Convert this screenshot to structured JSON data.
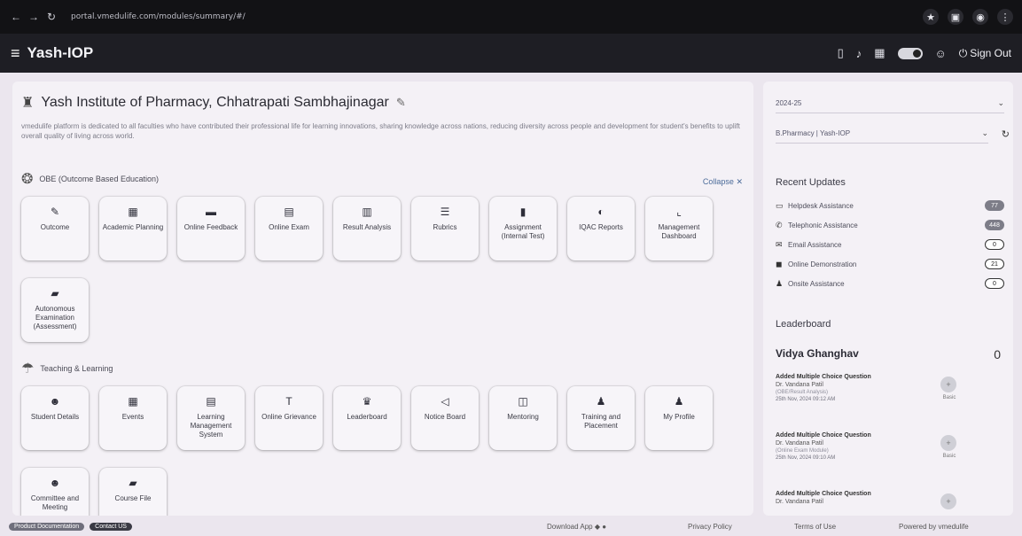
{
  "browser": {
    "url": "portal.vmedulife.com/modules/summary/#/"
  },
  "app": {
    "title": "Yash-IOP",
    "signout_label": "Sign Out"
  },
  "institute": {
    "title": "Yash Institute of Pharmacy, Chhatrapati Sambhajinagar",
    "description": "vmedulife platform is dedicated to all faculties who have contributed their professional life for learning innovations, sharing knowledge across nations, reducing diversity across people and development for student's benefits to uplift overall quality of living across world."
  },
  "obe": {
    "title": "OBE (Outcome Based Education)",
    "collapse_label": "Collapse",
    "tiles": [
      {
        "label": "Outcome",
        "icon": "✎"
      },
      {
        "label": "Academic Planning",
        "icon": "▦"
      },
      {
        "label": "Online Feedback",
        "icon": "▬"
      },
      {
        "label": "Online Exam",
        "icon": "▤"
      },
      {
        "label": "Result Analysis",
        "icon": "▥"
      },
      {
        "label": "Rubrics",
        "icon": "☰"
      },
      {
        "label": "Assignment (Internal Test)",
        "icon": "▮"
      },
      {
        "label": "IQAC Reports",
        "icon": "◐"
      },
      {
        "label": "Management Dashboard",
        "icon": "⌞"
      },
      {
        "label": "Autonomous Examination (Assessment)",
        "icon": "▰"
      }
    ]
  },
  "teaching": {
    "title": "Teaching & Learning",
    "tiles": [
      {
        "label": "Student Details",
        "icon": "☻"
      },
      {
        "label": "Events",
        "icon": "▦"
      },
      {
        "label": "Learning Management System",
        "icon": "▤"
      },
      {
        "label": "Online Grievance",
        "icon": "T"
      },
      {
        "label": "Leaderboard",
        "icon": "♛"
      },
      {
        "label": "Notice Board",
        "icon": "◁"
      },
      {
        "label": "Mentoring",
        "icon": "◫"
      },
      {
        "label": "Training and Placement",
        "icon": "♟"
      },
      {
        "label": "My Profile",
        "icon": "♟"
      },
      {
        "label": "Committee and Meeting",
        "icon": "☻"
      },
      {
        "label": "Course File",
        "icon": "▰"
      }
    ]
  },
  "right_panel": {
    "academic_year": "2024-25",
    "program": "B.Pharmacy | Yash-IOP",
    "recent_updates_title": "Recent Updates",
    "updates": [
      {
        "label": "Helpdesk Assistance",
        "count": "77",
        "icon": "▭",
        "style": "dark"
      },
      {
        "label": "Telephonic Assistance",
        "count": "448",
        "icon": "✆",
        "style": "dark"
      },
      {
        "label": "Email Assistance",
        "count": "0",
        "icon": "✉",
        "style": "outline"
      },
      {
        "label": "Online Demonstration",
        "count": "21",
        "icon": "◼",
        "style": "outline"
      },
      {
        "label": "Onsite Assistance",
        "count": "0",
        "icon": "♟",
        "style": "outline"
      }
    ],
    "leaderboard_title": "Leaderboard",
    "leader_name": "Vidya Ghanghav",
    "leader_score": "0",
    "activities": [
      {
        "title": "Added Multiple Choice Question",
        "by": "Dr. Vandana Patil",
        "meta": "(OBE/Result Analysis)",
        "time": "25th Nov, 2024 09:12 AM",
        "points": "Basic"
      },
      {
        "title": "Added Multiple Choice Question",
        "by": "Dr. Vandana Patil",
        "meta": "(Online Exam Module)",
        "time": "25th Nov, 2024 09:10 AM",
        "points": "Basic"
      },
      {
        "title": "Added Multiple Choice Question",
        "by": "Dr. Vandana Patil",
        "meta": "",
        "time": "",
        "points": ""
      }
    ]
  },
  "footer": {
    "product_doc": "Product Documentation",
    "contact_us": "Contact US",
    "download_app": "Download App",
    "privacy": "Privacy Policy",
    "terms": "Terms of Use",
    "powered": "Powered by vmedulife"
  }
}
